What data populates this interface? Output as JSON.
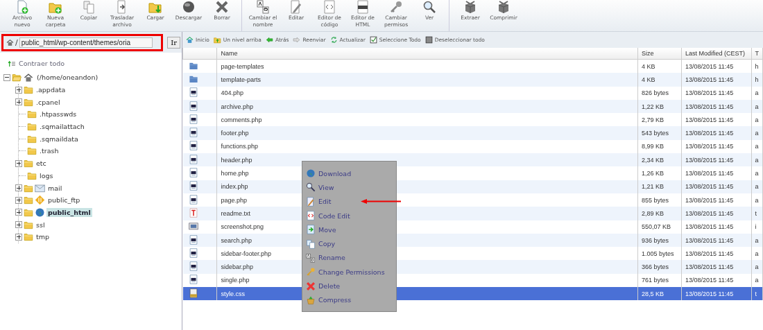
{
  "toolbar": {
    "groups": [
      {
        "items": [
          {
            "label": "Archivo nuevo"
          },
          {
            "label": "Nueva carpeta"
          },
          {
            "label": "Copiar"
          },
          {
            "label": "Trasladar archivo"
          },
          {
            "label": "Cargar"
          },
          {
            "label": "Descargar"
          },
          {
            "label": "Borrar"
          }
        ]
      },
      {
        "items": [
          {
            "label": "Cambiar el nombre"
          },
          {
            "label": "Editar"
          },
          {
            "label": "Editor de código"
          },
          {
            "label": "Editor de HTML"
          },
          {
            "label": "Cambiar permisos"
          },
          {
            "label": "Ver"
          }
        ]
      },
      {
        "items": [
          {
            "label": "Extraer"
          },
          {
            "label": "Comprimir"
          }
        ]
      }
    ]
  },
  "address": {
    "prefix": "/",
    "value": "public_html/wp-content/themes/oria",
    "button": "Ir"
  },
  "tree": {
    "collapse_all": "Contraer todo",
    "root": {
      "label": "(/home/oneandon)",
      "expanded": true,
      "children": [
        {
          "label": ".appdata",
          "kind": "folder",
          "expandable": true,
          "selected": false
        },
        {
          "label": ".cpanel",
          "kind": "folder",
          "expandable": true,
          "selected": false
        },
        {
          "label": ".htpasswds",
          "kind": "folder",
          "expandable": false,
          "selected": false
        },
        {
          "label": ".sqmailattach",
          "kind": "folder",
          "expandable": false,
          "selected": false
        },
        {
          "label": ".sqmaildata",
          "kind": "folder",
          "expandable": false,
          "selected": false
        },
        {
          "label": ".trash",
          "kind": "folder",
          "expandable": false,
          "selected": false
        },
        {
          "label": "etc",
          "kind": "folder",
          "expandable": true,
          "selected": false
        },
        {
          "label": "logs",
          "kind": "folder",
          "expandable": false,
          "selected": false
        },
        {
          "label": "mail",
          "kind": "mail",
          "expandable": true,
          "selected": false
        },
        {
          "label": "public_ftp",
          "kind": "ftp",
          "expandable": true,
          "selected": false
        },
        {
          "label": "public_html",
          "kind": "web",
          "expandable": true,
          "selected": true
        },
        {
          "label": "ssl",
          "kind": "folder",
          "expandable": true,
          "selected": false
        },
        {
          "label": "tmp",
          "kind": "folder",
          "expandable": true,
          "selected": false
        }
      ]
    }
  },
  "nav": [
    {
      "label": "Inicio"
    },
    {
      "label": "Un nivel arriba"
    },
    {
      "label": "Atrás"
    },
    {
      "label": "Reenviar"
    },
    {
      "label": "Actualizar"
    },
    {
      "label": "Seleccione Todo"
    },
    {
      "label": "Deseleccionar todo"
    }
  ],
  "table": {
    "columns": [
      "Name",
      "Size",
      "Last Modified (CEST)",
      "T"
    ],
    "rows": [
      {
        "kind": "folder",
        "name": "page-templates",
        "size": "4 KB",
        "modified": "13/08/2015 11:45",
        "column_5": "h",
        "selected": false
      },
      {
        "kind": "folder",
        "name": "template-parts",
        "size": "4 KB",
        "modified": "13/08/2015 11:45",
        "column_5": "h",
        "selected": false
      },
      {
        "kind": "php",
        "name": "404.php",
        "size": "826 bytes",
        "modified": "13/08/2015 11:45",
        "column_5": "a",
        "selected": false
      },
      {
        "kind": "php",
        "name": "archive.php",
        "size": "1,22 KB",
        "modified": "13/08/2015 11:45",
        "column_5": "a",
        "selected": false
      },
      {
        "kind": "php",
        "name": "comments.php",
        "size": "2,79 KB",
        "modified": "13/08/2015 11:45",
        "column_5": "a",
        "selected": false
      },
      {
        "kind": "php",
        "name": "footer.php",
        "size": "543 bytes",
        "modified": "13/08/2015 11:45",
        "column_5": "a",
        "selected": false
      },
      {
        "kind": "php",
        "name": "functions.php",
        "size": "8,99 KB",
        "modified": "13/08/2015 11:45",
        "column_5": "a",
        "selected": false
      },
      {
        "kind": "php",
        "name": "header.php",
        "size": "2,34 KB",
        "modified": "13/08/2015 11:45",
        "column_5": "a",
        "selected": false
      },
      {
        "kind": "php",
        "name": "home.php",
        "size": "1,26 KB",
        "modified": "13/08/2015 11:45",
        "column_5": "a",
        "selected": false
      },
      {
        "kind": "php",
        "name": "index.php",
        "size": "1,21 KB",
        "modified": "13/08/2015 11:45",
        "column_5": "a",
        "selected": false
      },
      {
        "kind": "php",
        "name": "page.php",
        "size": "855 bytes",
        "modified": "13/08/2015 11:45",
        "column_5": "a",
        "selected": false
      },
      {
        "kind": "text",
        "name": "readme.txt",
        "size": "2,89 KB",
        "modified": "13/08/2015 11:45",
        "column_5": "t",
        "selected": false
      },
      {
        "kind": "image",
        "name": "screenshot.png",
        "size": "550,07 KB",
        "modified": "13/08/2015 11:45",
        "column_5": "i",
        "selected": false
      },
      {
        "kind": "php",
        "name": "search.php",
        "size": "936 bytes",
        "modified": "13/08/2015 11:45",
        "column_5": "a",
        "selected": false
      },
      {
        "kind": "php",
        "name": "sidebar-footer.php",
        "size": "1.005 bytes",
        "modified": "13/08/2015 11:45",
        "column_5": "a",
        "selected": false
      },
      {
        "kind": "php",
        "name": "sidebar.php",
        "size": "366 bytes",
        "modified": "13/08/2015 11:45",
        "column_5": "a",
        "selected": false
      },
      {
        "kind": "php",
        "name": "single.php",
        "size": "761 bytes",
        "modified": "13/08/2015 11:45",
        "column_5": "a",
        "selected": false
      },
      {
        "kind": "css",
        "name": "style.css",
        "size": "28,5 KB",
        "modified": "13/08/2015 11:45",
        "column_5": "t",
        "selected": true
      }
    ]
  },
  "context_menu": {
    "items": [
      {
        "label": "Download"
      },
      {
        "label": "View"
      },
      {
        "label": "Edit",
        "pointed": true
      },
      {
        "label": "Code Edit"
      },
      {
        "label": "Move"
      },
      {
        "label": "Copy"
      },
      {
        "label": "Rename"
      },
      {
        "label": "Change Permissions"
      },
      {
        "label": "Delete"
      },
      {
        "label": "Compress"
      }
    ]
  }
}
